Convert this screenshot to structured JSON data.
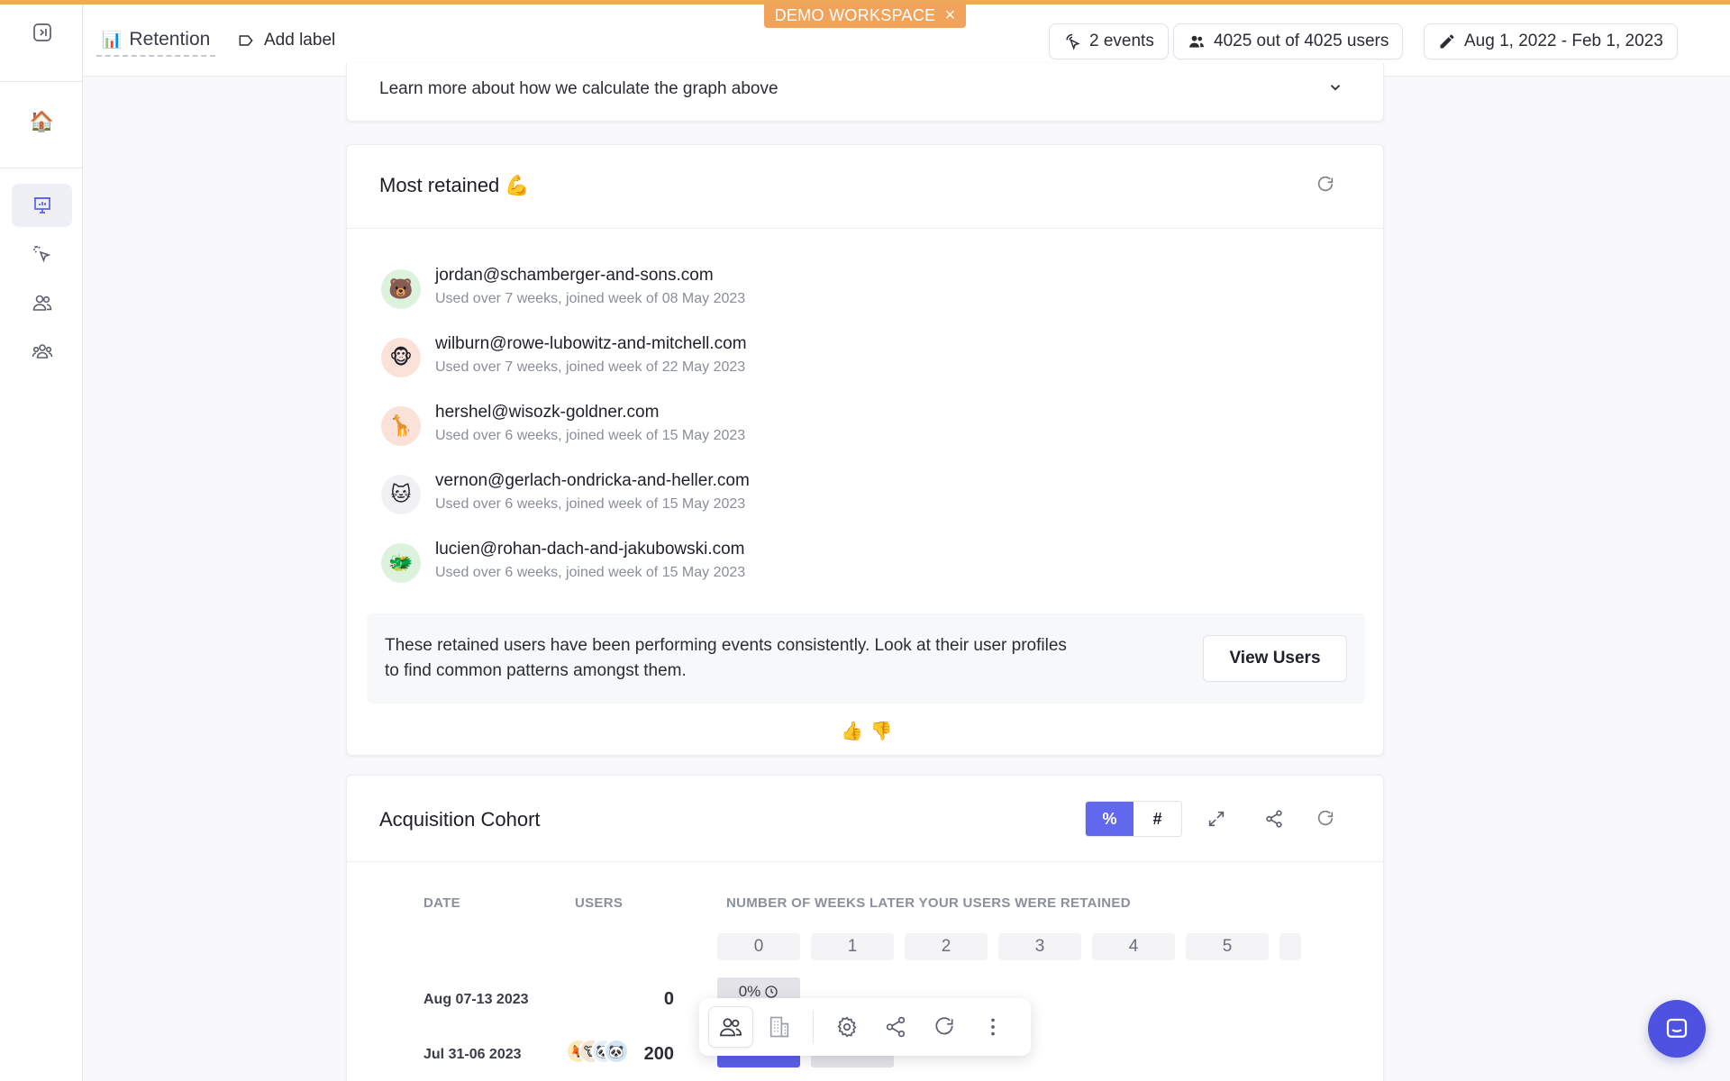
{
  "demo_banner": {
    "label": "DEMO WORKSPACE",
    "close": "×"
  },
  "header": {
    "title_emoji": "📊",
    "title": "Retention",
    "add_label": "Add label",
    "events_pill": "2 events",
    "users_pill": "4025 out of 4025 users",
    "date_pill": "Aug 1, 2022 - Feb 1, 2023"
  },
  "sidebar": {
    "items": [
      {
        "name": "toggle-sidebar",
        "icon": "panel-toggle-icon"
      },
      {
        "name": "home",
        "icon": "house-emoji"
      },
      {
        "name": "reports",
        "icon": "presentation-chart-icon",
        "active": true
      },
      {
        "name": "events",
        "icon": "cursor-click-icon"
      },
      {
        "name": "users",
        "icon": "users-icon"
      },
      {
        "name": "groups",
        "icon": "user-group-icon"
      }
    ],
    "home_emoji": "🏠"
  },
  "learn_more": {
    "label": "Learn more about how we calculate the graph above",
    "chevron": "⌄"
  },
  "most_retained": {
    "title": "Most retained 💪",
    "users": [
      {
        "email": "jordan@schamberger-and-sons.com",
        "detail": "Used over 7 weeks, joined week of 08 May 2023",
        "emoji": "🐻",
        "bg": "#dcf2dc"
      },
      {
        "email": "wilburn@rowe-lubowitz-and-mitchell.com",
        "detail": "Used over 7 weeks, joined week of 22 May 2023",
        "emoji": "🐵",
        "bg": "#fbe2d8"
      },
      {
        "email": "hershel@wisozk-goldner.com",
        "detail": "Used over 6 weeks, joined week of 15 May 2023",
        "emoji": "🦒",
        "bg": "#fbe2d8"
      },
      {
        "email": "vernon@gerlach-ondricka-and-heller.com",
        "detail": "Used over 6 weeks, joined week of 15 May 2023",
        "emoji": "🐱",
        "bg": "#f1f1f3"
      },
      {
        "email": "lucien@rohan-dach-and-jakubowski.com",
        "detail": "Used over 6 weeks, joined week of 15 May 2023",
        "emoji": "🐲",
        "bg": "#dcf2dc"
      }
    ],
    "insight": "These retained users have been performing events consistently. Look at their user profiles to find common patterns amongst them.",
    "view_users": "View Users",
    "thumbs_up": "👍",
    "thumbs_down": "👎"
  },
  "cohort": {
    "title": "Acquisition Cohort",
    "toggle_percent": "%",
    "toggle_number": "#",
    "columns": {
      "date": "DATE",
      "users": "USERS",
      "weeks": "NUMBER OF WEEKS LATER YOUR USERS WERE RETAINED"
    },
    "weeks": [
      "0",
      "1",
      "2",
      "3",
      "4",
      "5"
    ],
    "rows": [
      {
        "date": "Aug 07-13 2023",
        "users": "0",
        "cell0": "0%",
        "cell0_icon": "clock-icon"
      },
      {
        "date": "Jul 31-06 2023",
        "users": "200",
        "avatars": [
          "🦊",
          "🐮",
          "🐼",
          "🐼"
        ]
      }
    ]
  },
  "floating_toolbar": {
    "buttons": [
      "users-icon",
      "building-icon",
      "gear-icon",
      "share-icon",
      "refresh-icon",
      "more-icon"
    ]
  },
  "colors": {
    "accent": "#6168ee",
    "banner": "#f1a35c",
    "chat": "#4e52e0"
  }
}
